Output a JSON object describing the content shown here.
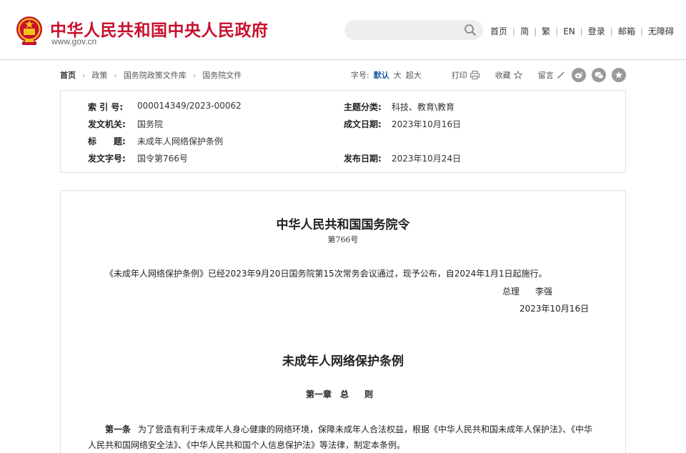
{
  "header": {
    "site_title": "中华人民共和国中央人民政府",
    "site_url": "www.gov.cn",
    "search": {
      "value": "",
      "placeholder": ""
    },
    "nav": [
      "首页",
      "简",
      "繁",
      "EN",
      "登录",
      "邮箱",
      "无障碍"
    ]
  },
  "breadcrumb": [
    "首页",
    "政策",
    "国务院政策文件库",
    "国务院文件"
  ],
  "tools": {
    "font_size_label": "字号:",
    "font_sizes": [
      "默认",
      "大",
      "超大"
    ],
    "print": "打印",
    "favorite": "收藏",
    "comment": "留言"
  },
  "meta": {
    "index_label": "索 引 号:",
    "index_value": "000014349/2023-00062",
    "category_label": "主题分类:",
    "category_value": "科技、教育\\教育",
    "issuer_label": "发文机关:",
    "issuer_value": "国务院",
    "created_label": "成文日期:",
    "created_value": "2023年10月16日",
    "title_label": "标　　题:",
    "title_value": "未成年人网络保护条例",
    "doc_no_label": "发文字号:",
    "doc_no_value": "国令第766号",
    "published_label": "发布日期:",
    "published_value": "2023年10月24日"
  },
  "article": {
    "order_title": "中华人民共和国国务院令",
    "order_number": "第766号",
    "intro": "《未成年人网络保护条例》已经2023年9月20日国务院第15次常务会议通过，现予公布，自2024年1月1日起施行。",
    "signer_title": "总理",
    "signer_name": "李强",
    "sign_date": "2023年10月16日",
    "regulation_title": "未成年人网络保护条例",
    "chapter_number": "第一章",
    "chapter_name": "总则",
    "article1_number": "第一条",
    "article1_text": "为了营造有利于未成年人身心健康的网络环境，保障未成年人合法权益，根据《中华人民共和国未成年人保护法》、《中华人民共和国网络安全法》、《中华人民共和国个人信息保护法》等法律，制定本条例。"
  },
  "colors": {
    "brand_red": "#c8102e",
    "emblem_gold": "#f2c21a",
    "link_blue": "#1f5ea8"
  },
  "icons": [
    "national-emblem-icon",
    "search-icon",
    "print-icon",
    "star-icon",
    "pen-icon",
    "weibo-icon",
    "wechat-icon",
    "favorite-icon"
  ]
}
